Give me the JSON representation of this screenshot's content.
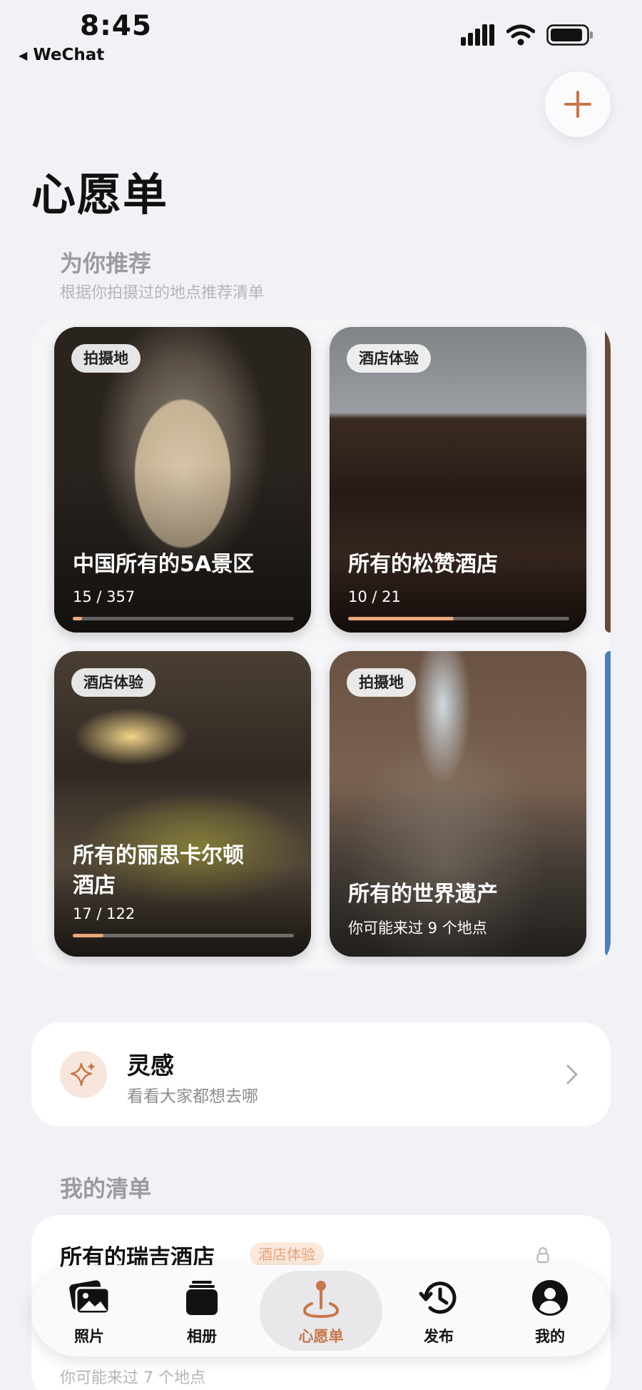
{
  "status": {
    "time": "8:45",
    "back_app": "WeChat"
  },
  "page": {
    "title": "心愿单"
  },
  "recommend": {
    "title": "为你推荐",
    "subtitle": "根据你拍摄过的地点推荐清单",
    "cards": [
      {
        "tag": "拍摄地",
        "name": "中国所有的5A景区",
        "count": "15 / 357",
        "progress": 0.042
      },
      {
        "tag": "酒店体验",
        "name": "所有的松赞酒店",
        "count": "10 / 21",
        "progress": 0.476
      },
      {
        "tag": "酒店体验",
        "name": "所有的丽思卡尔顿酒店",
        "count": "17 / 122",
        "progress": 0.139
      },
      {
        "tag": "拍摄地",
        "name": "所有的世界遗产",
        "count": "你可能来过 9 个地点"
      }
    ]
  },
  "inspiration": {
    "title": "灵感",
    "subtitle": "看看大家都想去哪",
    "icon": "sparkle-icon"
  },
  "my_lists": {
    "title": "我的清单",
    "items": [
      {
        "name": "所有的瑞吉酒店",
        "tag": "酒店体验",
        "subtitle": "你可能来过 7 个地点"
      }
    ]
  },
  "tabs": [
    {
      "label": "照片",
      "icon": "photos-icon"
    },
    {
      "label": "相册",
      "icon": "album-icon"
    },
    {
      "label": "心愿单",
      "icon": "wishlist-pin-icon",
      "active": true
    },
    {
      "label": "发布",
      "icon": "history-icon"
    },
    {
      "label": "我的",
      "icon": "profile-icon"
    }
  ],
  "colors": {
    "accent": "#c8764a",
    "progress": "#e9a97a",
    "background": "#f2f2f6"
  }
}
